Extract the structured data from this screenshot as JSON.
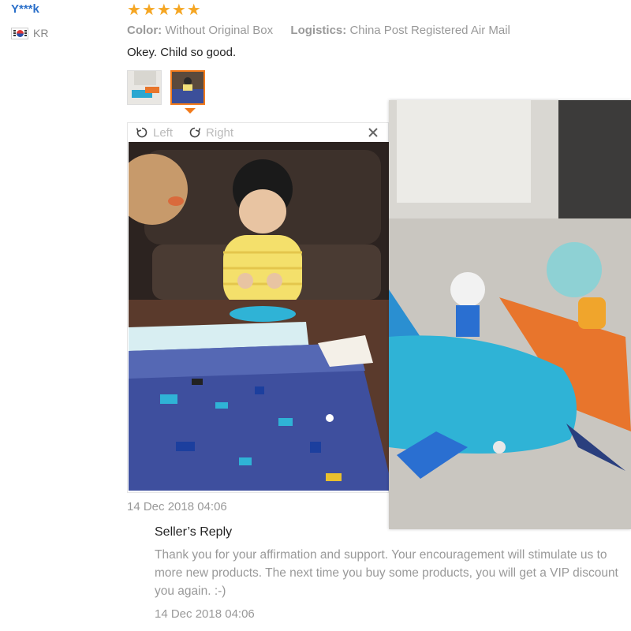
{
  "reviewer": {
    "name": "Y***k",
    "country": "KR",
    "flag_icon": "south-korea-flag"
  },
  "rating": {
    "stars": 5,
    "max": 5,
    "color": "#f5a623"
  },
  "meta": {
    "color_label": "Color:",
    "color_value": "Without Original Box",
    "logistics_label": "Logistics:",
    "logistics_value": "China Post Registered Air Mail"
  },
  "review_text": "Okey. Child so good.",
  "thumbnails": {
    "count": 2,
    "active_index": 1,
    "accent": "#f27a1a"
  },
  "viewer": {
    "rotate_left": "Left",
    "rotate_right": "Right",
    "close_icon": "close-icon"
  },
  "review_date": "14 Dec 2018 04:06",
  "seller_reply": {
    "title": "Seller’s Reply",
    "text": "Thank you for your affirmation and support. Your encouragement will stimulate us to\nmore new products. The next time you buy some products, you will get a VIP discount\nyou again. :-)",
    "date": "14 Dec 2018 04:06"
  }
}
